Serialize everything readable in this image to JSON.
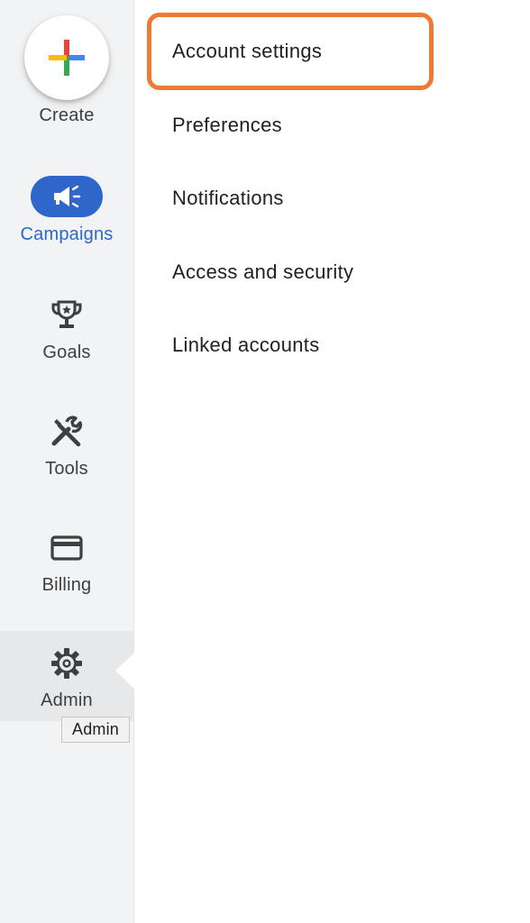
{
  "nav": {
    "create": {
      "label": "Create",
      "icon": "plus-multicolor-icon"
    },
    "campaigns": {
      "label": "Campaigns",
      "icon": "megaphone-icon",
      "active": true
    },
    "goals": {
      "label": "Goals",
      "icon": "trophy-icon"
    },
    "tools": {
      "label": "Tools",
      "icon": "tools-icon"
    },
    "billing": {
      "label": "Billing",
      "icon": "credit-card-icon"
    },
    "admin": {
      "label": "Admin",
      "icon": "gear-icon"
    }
  },
  "tooltip": {
    "text": "Admin"
  },
  "menu": {
    "items": [
      {
        "label": "Account settings",
        "highlighted": true
      },
      {
        "label": "Preferences"
      },
      {
        "label": "Notifications"
      },
      {
        "label": "Access and security"
      },
      {
        "label": "Linked accounts"
      }
    ]
  },
  "colors": {
    "accent": "#2f66c9",
    "highlight_outline": "#ee7a35",
    "rail_background": "#f1f3f4"
  }
}
